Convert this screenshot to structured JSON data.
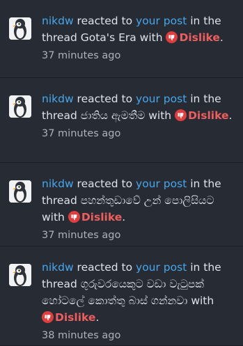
{
  "alerts": [
    {
      "user": "nikdw",
      "text_reacted": " reacted to ",
      "post_link": "your post",
      "text_thread": " in the thread Gota's Era with ",
      "reaction": "Dislike",
      "text_end": ".",
      "time": "37 minutes ago"
    },
    {
      "user": "nikdw",
      "text_reacted": " reacted to ",
      "post_link": "your post",
      "text_thread": " in the thread ජාතිය ඇමතීම with ",
      "reaction": "Dislike",
      "text_end": ".",
      "time": "37 minutes ago"
    },
    {
      "user": "nikdw",
      "text_reacted": " reacted to ",
      "post_link": "your post",
      "text_thread": " in the thread පහන්තුඩාවේ උන් පොලිසියට with ",
      "reaction": "Dislike",
      "text_end": ".",
      "time": "37 minutes ago"
    },
    {
      "user": "nikdw",
      "text_reacted": " reacted to ",
      "post_link": "your post",
      "text_thread": " in the thread ගුරුවරයෙකුට වඩා වැටුපක් හෝටලේ කොත්තු බාස් ගන්නවා with ",
      "reaction": "Dislike",
      "text_end": ".",
      "time": "38 minutes ago"
    }
  ],
  "colors": {
    "background": "#272b34",
    "link": "#47a7eb",
    "dislike": "#ef5e5e",
    "muted": "#aab3bd"
  },
  "icons": {
    "reaction": "thumbs-down-icon",
    "avatar": "penguin-avatar"
  }
}
